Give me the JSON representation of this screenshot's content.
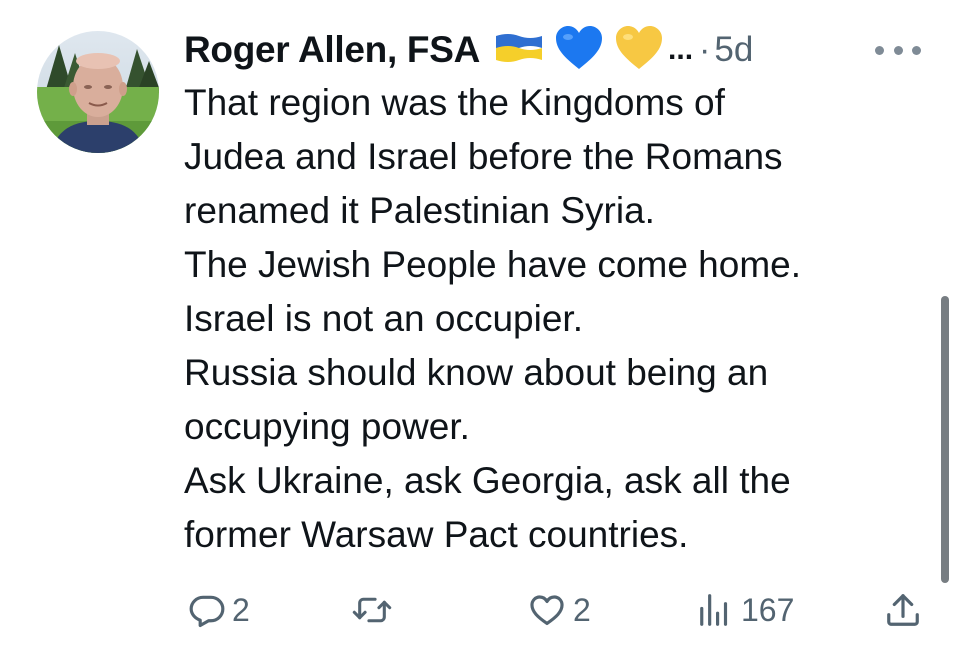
{
  "tweet": {
    "author": {
      "name": "Roger Allen, FSA",
      "badges": [
        "ukraine-flag-icon",
        "blue-heart-icon",
        "yellow-heart-icon"
      ],
      "truncation": "...",
      "separator": "·",
      "timestamp": "5d"
    },
    "body_lines": [
      "That region was the Kingdoms of",
      "Judea and Israel before the Romans",
      "renamed it Palestinian Syria.",
      "The Jewish People have come home.",
      "Israel is not an occupier.",
      "Russia should know about being an",
      "occupying power.",
      "Ask Ukraine, ask Georgia, ask all the",
      "former Warsaw Pact countries."
    ],
    "actions": {
      "replies": "2",
      "retweets": "",
      "likes": "2",
      "views": "167"
    }
  },
  "colors": {
    "text_primary": "#0f1419",
    "text_secondary": "#536471",
    "flag_blue": "#2f6fd1",
    "flag_yellow": "#f5cf2a",
    "blue_heart": "#1c78f0",
    "yellow_heart": "#f7c843"
  }
}
